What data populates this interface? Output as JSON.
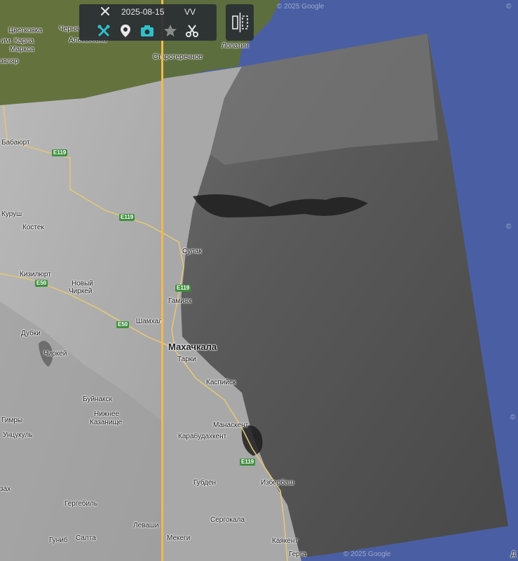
{
  "toolbar": {
    "date": "2025-08-15",
    "polarization": "VV",
    "buttons": [
      "tools-icon",
      "pin-icon",
      "camera-icon",
      "star-icon",
      "scissors-icon"
    ]
  },
  "attribution": {
    "top": "© 2025 Google",
    "bottom": "© 2025 Google",
    "right_top": "©",
    "right_mid": "©",
    "right_low": "©"
  },
  "places": [
    "Цветковка",
    "Черня",
    "им. Карла",
    "Маркса",
    "Алексеевка",
    "Старотеречное",
    "Лопатин",
    "звляр",
    "Бабаюрт",
    "Куруш",
    "Костек",
    "Кизилюрт",
    "Новый",
    "Чиркей",
    "Сулак",
    "Гамиях",
    "Шамхал",
    "Дубки",
    "Чиркей",
    "Махачкала",
    "Тарки",
    "Каспийск",
    "Буйнакск",
    "Нижнее",
    "Казанище",
    "Гимры",
    "Унцукуль",
    "Манаскент",
    "Карабудахкент",
    "Губден",
    "Избербаш",
    "Гергебиль",
    "Сергокала",
    "Леваши",
    "Гуниб",
    "Салта",
    "Мекеги",
    "Каякент",
    "Герга",
    "зах",
    "Д"
  ],
  "roads": [
    "E119",
    "E119",
    "E50",
    "E119",
    "E50",
    "E119"
  ],
  "colors": {
    "divider": "#f2b94e",
    "accent": "#2fc1c9",
    "sea": "#4a5fa3"
  }
}
